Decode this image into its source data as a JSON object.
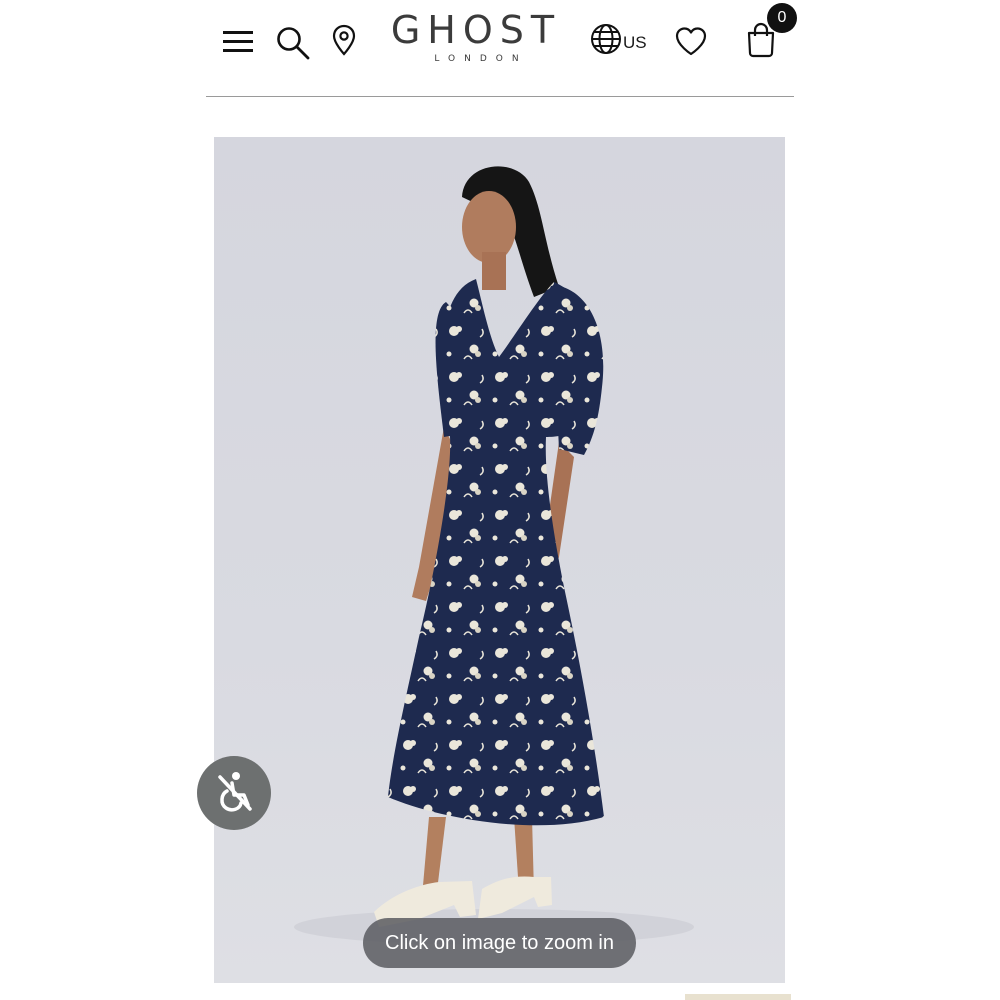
{
  "header": {
    "brand": "GHOST",
    "brand_sub": "LONDON",
    "region_label": "US",
    "cart_count": "0",
    "icons": [
      "menu-icon",
      "search-icon",
      "location-icon",
      "globe-icon",
      "heart-icon",
      "bag-icon"
    ]
  },
  "product": {
    "image_alt": "Woman wearing navy floral print midi dress",
    "zoom_hint": "Click on image to zoom in"
  },
  "accessibility": {
    "icon": "accessibility-icon"
  },
  "colors": {
    "text": "#1a1a1a",
    "badge_bg": "#111111",
    "image_bg": "#d8d9e0",
    "dress": "#1e2a4f",
    "accessibility_bg": "#6d7070"
  }
}
